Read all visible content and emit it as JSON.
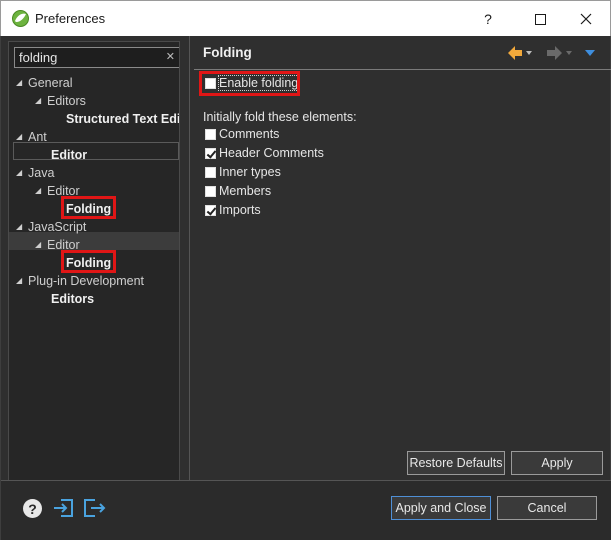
{
  "window": {
    "title": "Preferences",
    "controls": {
      "help": "?",
      "maximize": "☐",
      "close": "✕"
    }
  },
  "filter": {
    "value": "folding",
    "clear_icon": "✕"
  },
  "tree": [
    {
      "label": "General",
      "indent": 0,
      "twisty": "expanded",
      "bold": false
    },
    {
      "label": "Editors",
      "indent": 1,
      "twisty": "expanded",
      "bold": false
    },
    {
      "label": "Structured Text Edi",
      "indent": 2,
      "twisty": "none",
      "bold": true
    },
    {
      "label": "Ant",
      "indent": 0,
      "twisty": "expanded",
      "bold": false
    },
    {
      "label": "Editor",
      "indent": 1,
      "twisty": "none",
      "bold": true
    },
    {
      "label": "Java",
      "indent": 0,
      "twisty": "expanded",
      "bold": false
    },
    {
      "label": "Editor",
      "indent": 1,
      "twisty": "expanded",
      "bold": false
    },
    {
      "label": "Folding",
      "indent": 2,
      "twisty": "none",
      "bold": true
    },
    {
      "label": "JavaScript",
      "indent": 0,
      "twisty": "expanded",
      "bold": false
    },
    {
      "label": "Editor",
      "indent": 1,
      "twisty": "expanded",
      "bold": false
    },
    {
      "label": "Folding",
      "indent": 2,
      "twisty": "none",
      "bold": true
    },
    {
      "label": "Plug-in Development",
      "indent": 0,
      "twisty": "expanded",
      "bold": false
    },
    {
      "label": "Editors",
      "indent": 1,
      "twisty": "none",
      "bold": true
    }
  ],
  "page": {
    "title": "Folding",
    "enable_folding": {
      "label": "Enable folding",
      "checked": false
    },
    "section_label": "Initially fold these elements:",
    "elements": [
      {
        "label": "Comments",
        "checked": false
      },
      {
        "label": "Header Comments",
        "checked": true
      },
      {
        "label": "Inner types",
        "checked": false
      },
      {
        "label": "Members",
        "checked": false
      },
      {
        "label": "Imports",
        "checked": true
      }
    ]
  },
  "buttons": {
    "restore_defaults": "Restore Defaults",
    "apply": "Apply",
    "apply_and_close": "Apply and Close",
    "cancel": "Cancel"
  },
  "colors": {
    "highlight_box": "#e01616",
    "nav_back_arrow": "#f2a93b",
    "nav_menu_arrow": "#3e8ede",
    "footer_icons": "#4aa3df"
  },
  "icons": {
    "back": "back-arrow-icon",
    "forward": "forward-arrow-icon",
    "menu": "view-menu-icon",
    "help": "help-icon",
    "import": "import-icon",
    "export": "export-icon"
  }
}
